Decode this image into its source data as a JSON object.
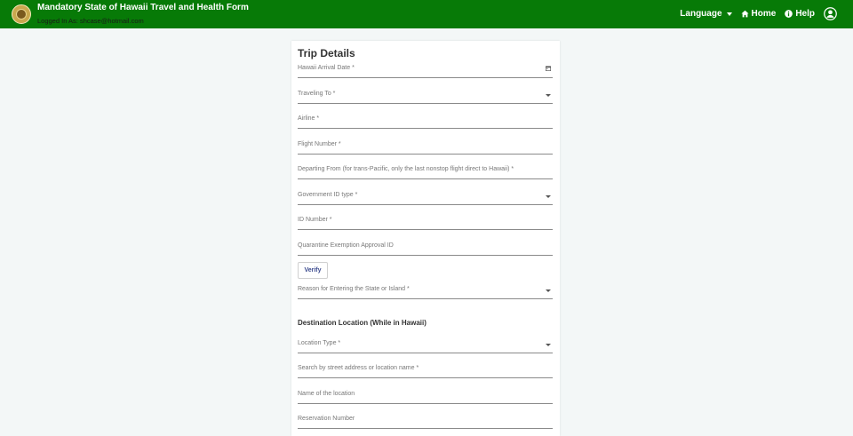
{
  "header": {
    "title": "Mandatory State of Hawaii Travel and Health Form",
    "logged_in": "Logged In As: shcase@hotmail.com",
    "nav": {
      "language": "Language",
      "home": "Home",
      "help": "Help"
    },
    "icons": {
      "seal": "state-seal-icon",
      "home": "home-icon",
      "help": "info-icon",
      "user": "user-account-icon"
    }
  },
  "form": {
    "title": "Trip Details",
    "fields": {
      "arrival_date": "Hawaii Arrival Date *",
      "traveling_to": "Traveling To *",
      "airline": "Airline *",
      "flight_number": "Flight Number *",
      "departing_from": "Departing From (for trans-Pacific, only the last nonstop flight direct to Hawaii) *",
      "gov_id_type": "Government ID type *",
      "id_number": "ID Number *",
      "quarantine_id": "Quarantine Exemption Approval ID",
      "reason": "Reason for Entering the State or Island *",
      "location_type": "Location Type *",
      "search_address": "Search by street address or location name *",
      "location_name": "Name of the location",
      "reservation_number": "Reservation Number"
    },
    "verify_label": "Verify",
    "destination_section": "Destination Location (While in Hawaii)"
  },
  "colors": {
    "header_bg": "#077a07",
    "page_bg": "#f3f7f7",
    "button_text": "#3c4b8f"
  }
}
